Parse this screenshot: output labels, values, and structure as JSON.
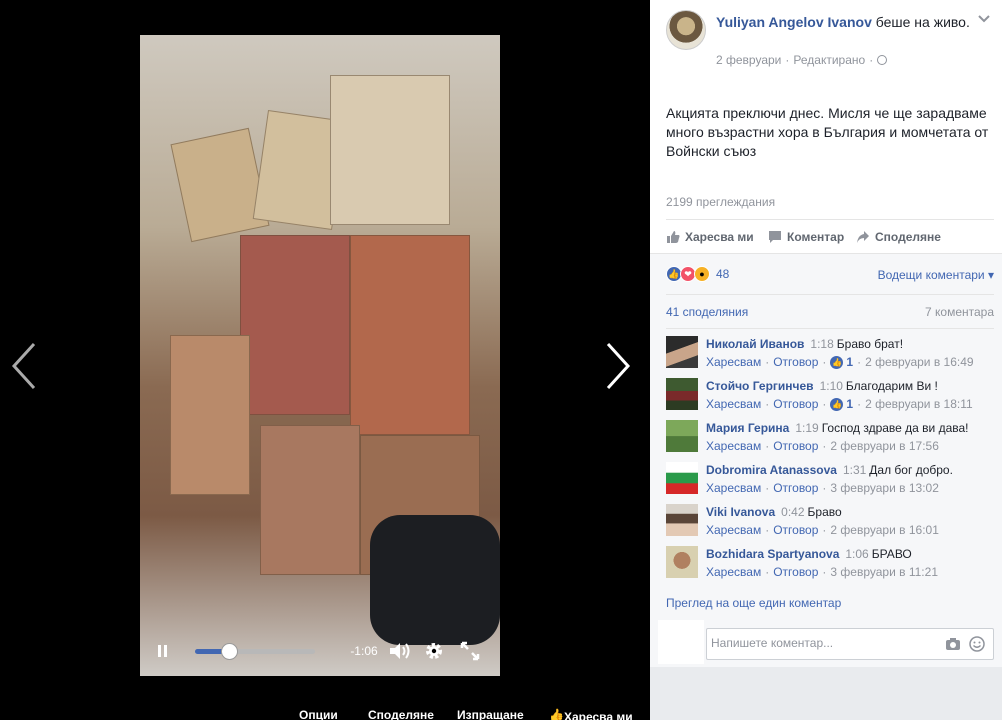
{
  "player": {
    "time_remaining": "-1:06",
    "progress": 0.28
  },
  "bottom_bar": {
    "options": "Опции",
    "share": "Споделяне",
    "embed": "Изпращане",
    "like": "Харесва ми"
  },
  "post": {
    "author": "Yuliyan Angelov Ivanov",
    "status_suffix": "беше на живо.",
    "date": "2 февруари",
    "separator": "·",
    "edited": "Редактирано",
    "text": "Акцията преключи днес. Мисля че ще зарадваме много възрастни хора в България и момчетата от Войнски съюз",
    "views": "2199 преглеждания"
  },
  "actions": {
    "like": "Харесва ми",
    "comment": "Коментар",
    "share": "Споделяне"
  },
  "reactions": {
    "count": "48",
    "top_comments": "Водещи коментари"
  },
  "stats": {
    "shares": "41 споделяния",
    "comments": "7 коментара"
  },
  "comment_actions": {
    "like": "Харесвам",
    "reply": "Отговор"
  },
  "comments": [
    {
      "name": "Николай Иванов",
      "ts": "1:18",
      "text": "Браво брат!",
      "likes": "1",
      "date": "2 февруари в 16:49"
    },
    {
      "name": "Стойчо Гергинчев",
      "ts": "1:10",
      "text": "Благодарим Ви !",
      "likes": "1",
      "date": "2 февруари в 18:11"
    },
    {
      "name": "Мария Герина",
      "ts": "1:19",
      "text": "Господ здраве да ви дава!",
      "likes": "",
      "date": "2 февруари в 17:56"
    },
    {
      "name": "Dobromira Atanassova",
      "ts": "1:31",
      "text": "Дал бог добро.",
      "likes": "",
      "date": "3 февруари в 13:02"
    },
    {
      "name": "Viki Ivanova",
      "ts": "0:42",
      "text": "Браво",
      "likes": "",
      "date": "2 февруари в 16:01"
    },
    {
      "name": "Bozhidara Spartyanova",
      "ts": "1:06",
      "text": "БРАВО",
      "likes": "",
      "date": "3 февруари в 11:21"
    }
  ],
  "more_comments": "Преглед на още един коментар",
  "compose": {
    "placeholder": "Напишете коментар..."
  },
  "colors": {
    "link": "#365899",
    "accent": "#4267b2",
    "muted": "#90949c"
  }
}
